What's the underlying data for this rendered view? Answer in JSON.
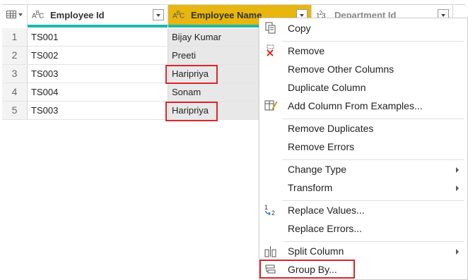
{
  "table": {
    "columns": [
      {
        "type_icon": "abc-type-icon",
        "label": "Employee Id"
      },
      {
        "type_icon": "abc-type-icon",
        "label": "Employee Name",
        "selected": true
      },
      {
        "type_icon": "123-type-icon",
        "label": "Department Id"
      }
    ],
    "rows": [
      {
        "num": "1",
        "id": "TS001",
        "name": "Bijay Kumar"
      },
      {
        "num": "2",
        "id": "TS002",
        "name": "Preeti"
      },
      {
        "num": "3",
        "id": "TS003",
        "name": "Haripriya"
      },
      {
        "num": "4",
        "id": "TS004",
        "name": "Sonam"
      },
      {
        "num": "5",
        "id": "TS003",
        "name": "Haripriya"
      }
    ]
  },
  "menu": {
    "copy": "Copy",
    "remove": "Remove",
    "remove_other": "Remove Other Columns",
    "duplicate": "Duplicate Column",
    "add_from_examples": "Add Column From Examples...",
    "remove_duplicates": "Remove Duplicates",
    "remove_errors": "Remove Errors",
    "change_type": "Change Type",
    "transform": "Transform",
    "replace_values": "Replace Values...",
    "replace_errors": "Replace Errors...",
    "split_column": "Split Column",
    "group_by": "Group By..."
  },
  "colors": {
    "selected_header": "#e8b70f",
    "quality_bar": "#1fb7a9",
    "highlight_box": "#d9262b"
  }
}
